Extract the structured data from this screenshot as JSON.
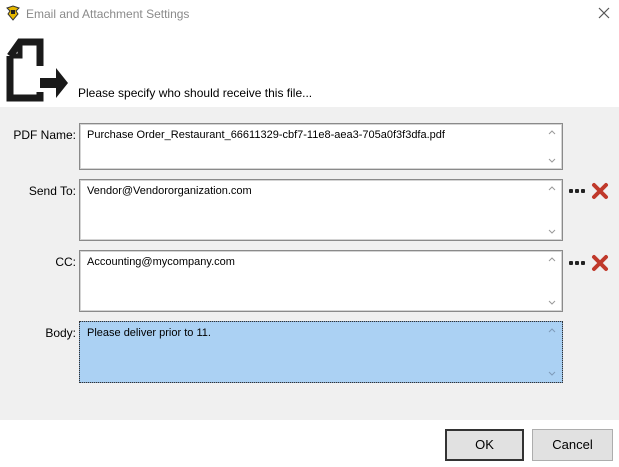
{
  "window": {
    "title": "Email and Attachment Settings"
  },
  "header": {
    "prompt": "Please specify who should receive this file..."
  },
  "fields": {
    "pdf_name": {
      "label": "PDF Name:",
      "value": "Purchase Order_Restaurant_66611329-cbf7-11e8-aea3-705a0f3f3dfa.pdf"
    },
    "send_to": {
      "label": "Send To:",
      "value": "Vendor@Vendororganization.com"
    },
    "cc": {
      "label": "CC:",
      "value": "Accounting@mycompany.com"
    },
    "body": {
      "label": "Body:",
      "value": "Please deliver prior to 11."
    }
  },
  "buttons": {
    "ok": "OK",
    "cancel": "Cancel"
  },
  "colors": {
    "panel": "#f0f0f0",
    "body_highlight": "#abd1f3",
    "delete_red": "#c0392b"
  },
  "icons": {
    "app": "app-logo-icon",
    "close": "close-icon",
    "header": "file-export-icon",
    "browse": "ellipsis-icon",
    "delete": "delete-x-icon",
    "scroll_up": "chevron-up-icon",
    "scroll_down": "chevron-down-icon"
  }
}
